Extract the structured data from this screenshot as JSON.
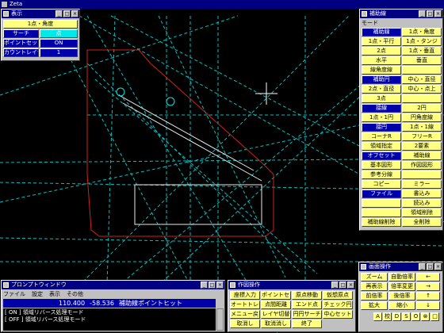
{
  "app_title": "Zeta",
  "colors": {
    "canvas": "#000000",
    "guide": "#00c0c0",
    "shape": "#d02020",
    "menu_active": "#0000a8",
    "menu_yellow": "#ffff80",
    "cyan": "#00e8e8"
  },
  "settings": {
    "title": "表示",
    "mode": "1点・角度",
    "search_label": "サーチ",
    "search_value": "点",
    "point_set_label": "ポイントセット",
    "point_set_value": "ON",
    "count_label": "カウントレイヤ",
    "count_value": "1"
  },
  "aux": {
    "title": "補助線",
    "section": "モード",
    "cells": [
      [
        "補助線",
        "1点・角度"
      ],
      [
        "1点・平行",
        "1点・タンジ"
      ],
      [
        "2点",
        "1点・垂直"
      ],
      [
        "水平",
        "垂直"
      ],
      [
        "線角度線",
        ""
      ],
      [
        "補助円",
        "中心・直径"
      ],
      [
        "2点・直径",
        "中心・点上"
      ],
      [
        "3点",
        ""
      ],
      [
        "接線",
        "2円"
      ],
      [
        "1点・1円",
        "円角度線"
      ],
      [
        "接円",
        "1点・1線"
      ],
      [
        "コーナR",
        "フリーR"
      ],
      [
        "領域指定",
        "2要素"
      ],
      [
        "オフセット",
        "補助線"
      ],
      [
        "基本図形",
        "作図図形"
      ],
      [
        "参考分線",
        ""
      ],
      [
        "コピー",
        "ミラー"
      ],
      [
        "ファイル",
        "書込み"
      ],
      [
        "",
        "読込み"
      ],
      [
        "",
        "領域削除"
      ],
      [
        "補助線削除",
        "全削除"
      ]
    ]
  },
  "prompt": {
    "title": "プロンプトウィンドウ",
    "menu": [
      "ファイル",
      "設定",
      "表示",
      "その他"
    ],
    "x": "110.400",
    "y": "-58.536",
    "message": "補助線ポイントヒット",
    "log": [
      "[ ON ] 領域リバース処理モード",
      "[ OFF ] 領域リバース処理モード"
    ]
  },
  "ops": {
    "title": "作図操作",
    "rows": [
      [
        "座標入力",
        "ポイントセット",
        "原点移動",
        "仮想原点"
      ],
      [
        "オートトレース",
        "点間距離",
        "エンド点",
        "チェック円"
      ],
      [
        "メニュー戻る",
        "レイヤ切替",
        "円円サーチ",
        "中心セット"
      ],
      [
        "取消し",
        "取消消し",
        "終了",
        ""
      ]
    ]
  },
  "view": {
    "title": "画面操作",
    "rows": [
      [
        "ズーム",
        "自動倍率",
        "←"
      ],
      [
        "再表示",
        "倍率変更",
        "→"
      ],
      [
        "前倍率",
        "後倍率",
        "↑"
      ],
      [
        "拡大",
        "縮小",
        "↓"
      ]
    ],
    "tools": [
      "A",
      "校",
      "D",
      "S",
      "O",
      "⊗",
      "□"
    ]
  }
}
